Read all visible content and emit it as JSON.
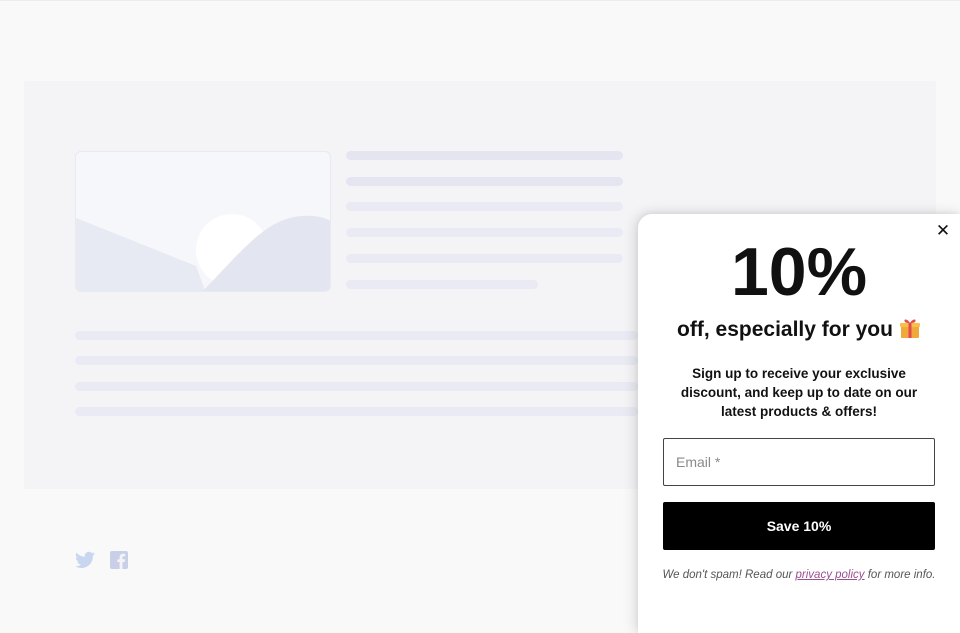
{
  "popup": {
    "discount_big": "10%",
    "headline": "off, especially for you",
    "gift_icon": "gift-icon",
    "description": "Sign up to receive your exclusive discount, and keep up to date on our latest products & offers!",
    "email_placeholder": "Email *",
    "email_value": "",
    "submit_label": "Save 10%",
    "fineprint_before": "We don't spam! Read our ",
    "privacy_link": "privacy policy",
    "fineprint_after": " for more info.",
    "close_icon": "close-icon"
  },
  "background": {
    "social_icons": [
      "twitter-icon",
      "facebook-icon"
    ]
  },
  "colors": {
    "button_bg": "#000000",
    "link": "#9b4f8f",
    "skeleton": "#e9eaf3"
  }
}
